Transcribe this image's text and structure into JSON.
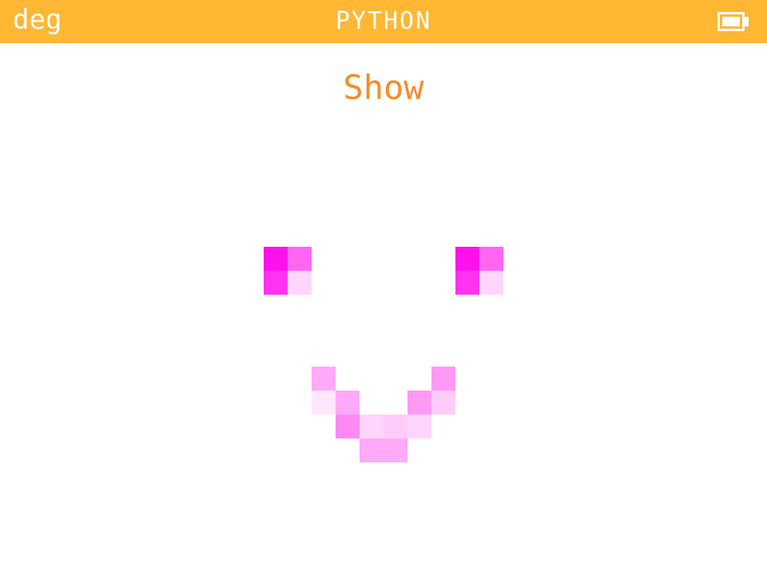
{
  "status_bar": {
    "angle_unit": "deg",
    "app_name": "PYTHON",
    "battery_icon": "battery-full-icon",
    "background_color": "#ffb734"
  },
  "main": {
    "title": "Show",
    "title_color": "#f58d2a"
  },
  "led_matrix": {
    "columns": 10,
    "rows": 9,
    "pixels": [
      {
        "col": 0,
        "row": 0,
        "color": "#ff11ee"
      },
      {
        "col": 1,
        "row": 0,
        "color": "#ff66f4"
      },
      {
        "col": 0,
        "row": 1,
        "color": "#ff33f0"
      },
      {
        "col": 1,
        "row": 1,
        "color": "#ffd5fb"
      },
      {
        "col": 8,
        "row": 0,
        "color": "#ff11ee"
      },
      {
        "col": 9,
        "row": 0,
        "color": "#ff66f4"
      },
      {
        "col": 8,
        "row": 1,
        "color": "#ff33f0"
      },
      {
        "col": 9,
        "row": 1,
        "color": "#ffd5fb"
      },
      {
        "col": 2,
        "row": 5,
        "color": "#ffaaf8"
      },
      {
        "col": 7,
        "row": 5,
        "color": "#ff99f6"
      },
      {
        "col": 2,
        "row": 6,
        "color": "#ffe6fc"
      },
      {
        "col": 3,
        "row": 6,
        "color": "#ffaaf8"
      },
      {
        "col": 6,
        "row": 6,
        "color": "#ff99f6"
      },
      {
        "col": 7,
        "row": 6,
        "color": "#ffccfa"
      },
      {
        "col": 3,
        "row": 7,
        "color": "#ff88f5"
      },
      {
        "col": 4,
        "row": 7,
        "color": "#ffd5fb"
      },
      {
        "col": 5,
        "row": 7,
        "color": "#ffccfa"
      },
      {
        "col": 6,
        "row": 7,
        "color": "#ffd5fb"
      },
      {
        "col": 4,
        "row": 8,
        "color": "#ffaaf8"
      },
      {
        "col": 5,
        "row": 8,
        "color": "#ffaaf8"
      }
    ]
  }
}
